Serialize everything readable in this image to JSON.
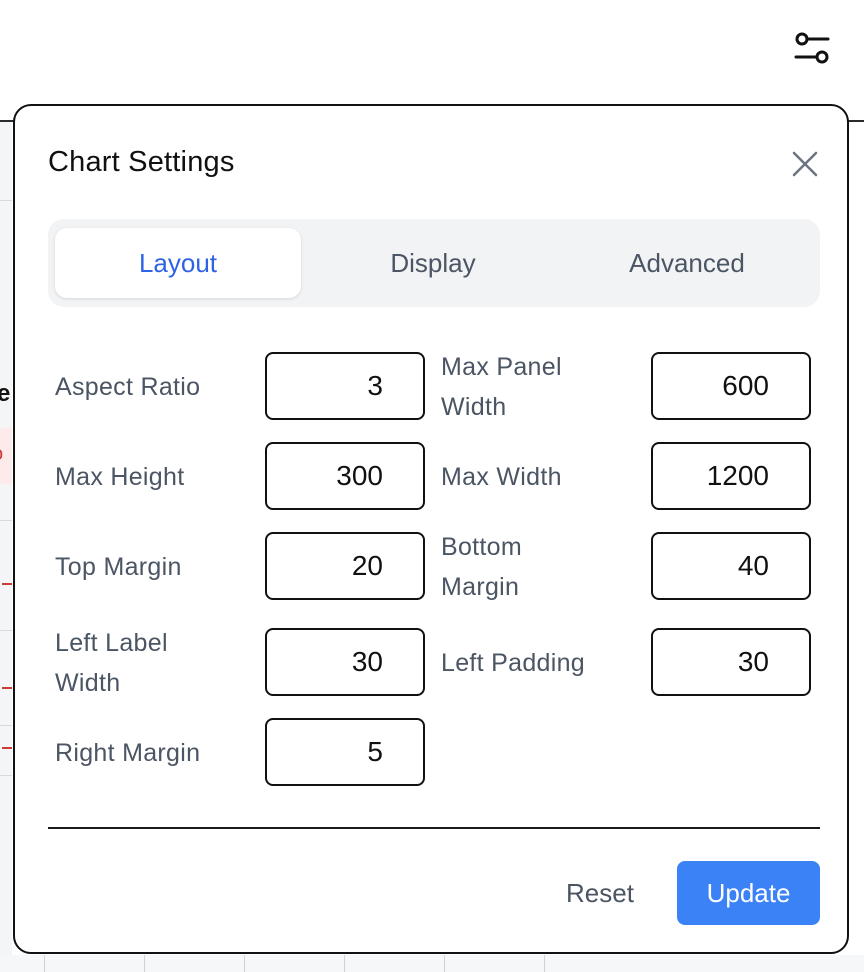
{
  "dialog": {
    "title": "Chart Settings"
  },
  "tabs": [
    {
      "label": "Layout",
      "active": true
    },
    {
      "label": "Display",
      "active": false
    },
    {
      "label": "Advanced",
      "active": false
    }
  ],
  "fields": {
    "aspect_ratio": {
      "label": "Aspect Ratio",
      "value": "3"
    },
    "max_panel_width": {
      "label_line1": "Max Panel",
      "label_line2": "Width",
      "value": "600"
    },
    "max_height": {
      "label": "Max Height",
      "value": "300"
    },
    "max_width": {
      "label": "Max Width",
      "value": "1200"
    },
    "top_margin": {
      "label": "Top Margin",
      "value": "20"
    },
    "bottom_margin": {
      "label_line1": "Bottom",
      "label_line2": "Margin",
      "value": "40"
    },
    "left_label_width": {
      "label_line1": "Left Label",
      "label_line2": "Width",
      "value": "30"
    },
    "left_padding": {
      "label": "Left Padding",
      "value": "30"
    },
    "right_margin": {
      "label": "Right Margin",
      "value": "5"
    }
  },
  "footer": {
    "reset_label": "Reset",
    "update_label": "Update"
  },
  "icons": {
    "settings": "sliders-icon",
    "close": "close-icon"
  },
  "colors": {
    "accent": "#3b82f6",
    "active_tab_text": "#2f63e6",
    "label_text": "#4b5563",
    "tab_background": "#f2f3f5"
  }
}
